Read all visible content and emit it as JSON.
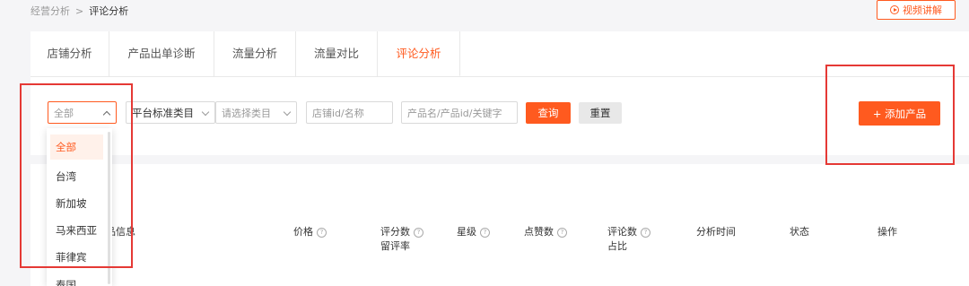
{
  "breadcrumb": {
    "parent": "经营分析",
    "sep": ">",
    "current": "评论分析"
  },
  "video_button": {
    "label": "视频讲解"
  },
  "tabs": [
    {
      "label": "店铺分析"
    },
    {
      "label": "产品出单诊断"
    },
    {
      "label": "流量分析"
    },
    {
      "label": "流量对比"
    },
    {
      "label": "评论分析"
    }
  ],
  "filters": {
    "region_select": "全部",
    "category_label": "平台标准类目",
    "category_placeholder": "请选择类目",
    "shop_placeholder": "店铺id/名称",
    "product_placeholder": "产品名/产品id/关键字",
    "query_label": "查询",
    "reset_label": "重置"
  },
  "add_product": {
    "label": "+ 添加产品"
  },
  "table_headers": {
    "product_info": "品信息",
    "price": "价格",
    "rating_count": "评分数",
    "retention": "留评率",
    "stars": "星级",
    "likes": "点赞数",
    "comment_count": "评论数",
    "ratio": "占比",
    "analysis_time": "分析时间",
    "status": "状态",
    "action": "操作"
  },
  "dropdown": {
    "options": [
      "全部",
      "台湾",
      "新加坡",
      "马来西亚",
      "菲律宾",
      "泰国"
    ],
    "selected": "全部"
  },
  "colors": {
    "accent": "#ff5a1f",
    "highlight_box": "#e53935"
  }
}
